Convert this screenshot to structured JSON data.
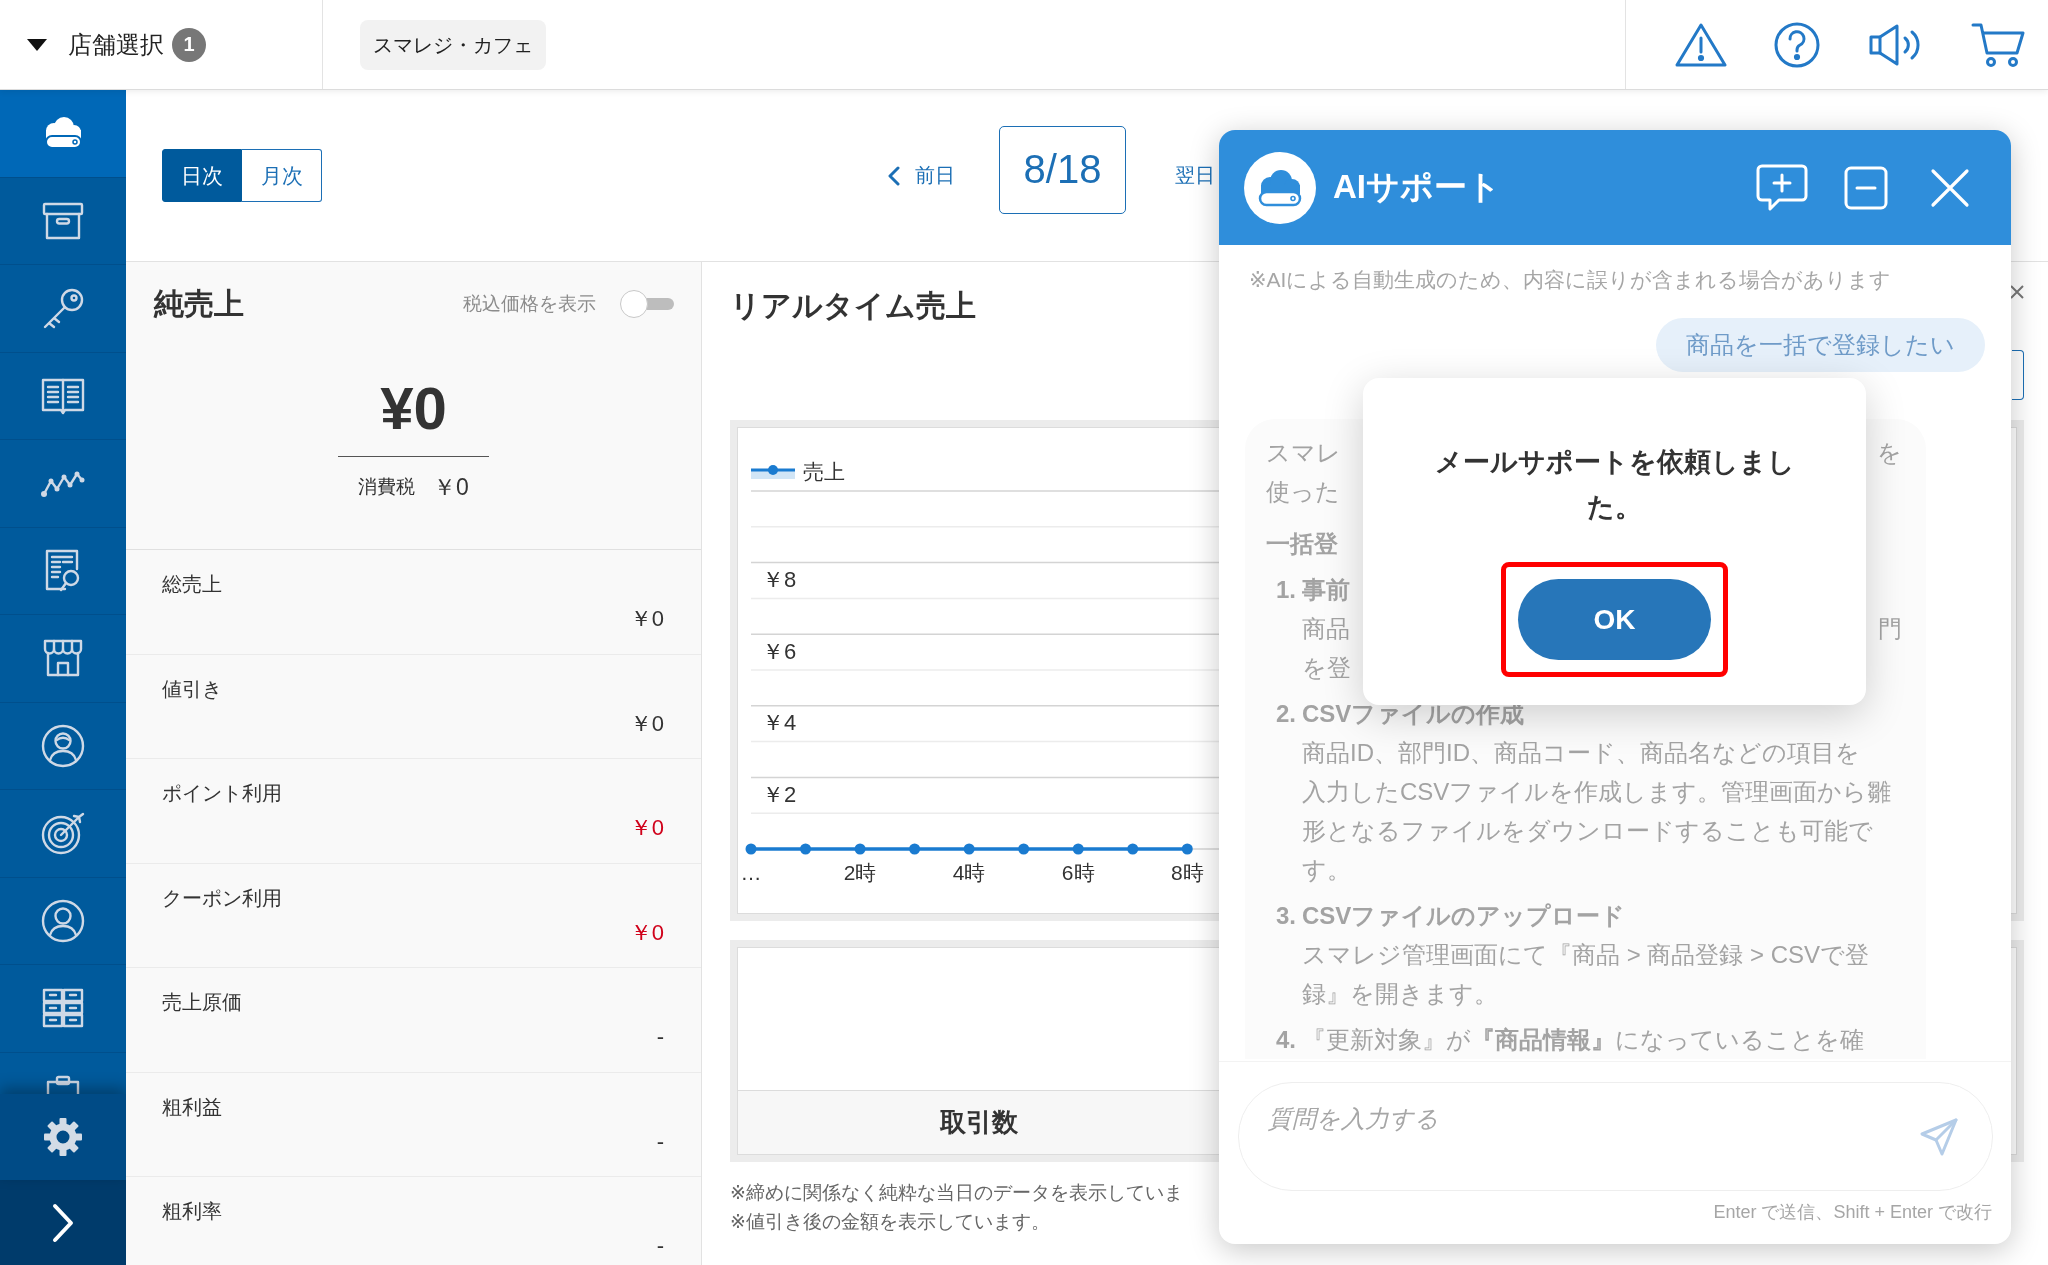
{
  "store_selector": {
    "label": "店舗選択",
    "count": "1"
  },
  "store_chip": {
    "label": "スマレジ・カフェ"
  },
  "sidebar": {
    "items": [
      {
        "selected": true
      },
      {
        "selected": false
      },
      {
        "selected": false
      },
      {
        "selected": false
      },
      {
        "selected": false
      },
      {
        "selected": false
      },
      {
        "selected": false
      },
      {
        "selected": false
      },
      {
        "selected": false
      },
      {
        "selected": false
      },
      {
        "selected": false
      },
      {
        "selected": false
      }
    ]
  },
  "period_tabs": [
    {
      "label": "日次",
      "selected": true
    },
    {
      "label": "月次",
      "selected": false
    }
  ],
  "date_nav": {
    "previous": "前日",
    "date": "8/18",
    "next": "翌日"
  },
  "net_sales": {
    "title": "純売上",
    "tax_toggle": {
      "label": "税込価格を表示",
      "on": false
    },
    "amount": "¥0",
    "tax_label": "消費税",
    "tax_amount": "￥0",
    "rows": [
      {
        "label": "総売上",
        "value": "￥0",
        "negative": false
      },
      {
        "label": "値引き",
        "value": "￥0",
        "negative": false
      },
      {
        "label": "ポイント利用",
        "value": "￥0",
        "negative": true
      },
      {
        "label": "クーポン利用",
        "value": "￥0",
        "negative": true
      },
      {
        "label": "売上原価",
        "value": "-",
        "negative": false
      },
      {
        "label": "粗利益",
        "value": "-",
        "negative": false
      },
      {
        "label": "粗利率",
        "value": "-",
        "negative": false
      }
    ]
  },
  "realtime_sales": {
    "title": "リアルタイム売上",
    "chart_data": {
      "type": "line",
      "x": [
        0,
        1,
        2,
        3,
        4,
        5,
        6,
        7,
        8
      ],
      "xlim": [
        0,
        8.6
      ],
      "xticks": [
        {
          "value": 0,
          "label": "…"
        },
        {
          "value": 2,
          "label": "2時"
        },
        {
          "value": 4,
          "label": "4時"
        },
        {
          "value": 6,
          "label": "6時"
        },
        {
          "value": 8,
          "label": "8時"
        }
      ],
      "ylim": [
        0,
        10
      ],
      "yticks": [
        {
          "value": 2,
          "label": "￥2"
        },
        {
          "value": 4,
          "label": "￥4"
        },
        {
          "value": 6,
          "label": "￥6"
        },
        {
          "value": 8,
          "label": "￥8"
        }
      ],
      "grid": true,
      "series": [
        {
          "name": "売上",
          "color": "#1a7bd0",
          "marker": "circle",
          "values": [
            0,
            0,
            0,
            0,
            0,
            0,
            0,
            0,
            0
          ]
        }
      ]
    },
    "transactions_label": "取引数",
    "notes": [
      "※締めに関係なく純粋な当日のデータを表示していま",
      "※値引き後の金額を表示しています。"
    ]
  },
  "ai_support": {
    "title": "AIサポート",
    "disclaimer": "※AIによる自動生成のため、内容に誤りが含まれる場合があります",
    "user_message": "商品を一括で登録したい",
    "reply": [
      {
        "kind": "paragraph",
        "lines": [
          {
            "text": "スマレ",
            "tail": "を"
          },
          {
            "text": "使った"
          }
        ]
      },
      {
        "kind": "heading",
        "lines": [
          {
            "text": "一括登"
          }
        ]
      },
      {
        "kind": "step",
        "number": "1.",
        "title": "事前",
        "lines": [
          {
            "text": "商品",
            "tail": "門"
          },
          {
            "text": "を登"
          }
        ]
      },
      {
        "kind": "step",
        "number": "2.",
        "title": "CSVファイルの作成",
        "lines": [
          {
            "text": "商品ID、部門ID、商品コード、商品名などの項目を"
          },
          {
            "text": "入力したCSVファイルを作成します。管理画面から雛"
          },
          {
            "text": "形となるファイルをダウンロードすることも可能で"
          },
          {
            "text": "す。"
          }
        ]
      },
      {
        "kind": "step",
        "number": "3.",
        "title": "CSVファイルのアップロード",
        "lines": [
          {
            "text": "スマレジ管理画面にて『商品 > 商品登録 > CSVで登"
          },
          {
            "text": "録』を開きます。"
          }
        ]
      },
      {
        "kind": "step_note",
        "number": "4.",
        "title": "『更新対象』が**『商品情報』**になっていることを確"
      }
    ],
    "input": {
      "placeholder": "質問を入力する"
    },
    "hint": "Enter で送信、Shift + Enter で改行"
  },
  "dialog": {
    "message": "メールサポートを依頼しました。",
    "button": {
      "label": "OK",
      "highlighted": true
    }
  }
}
